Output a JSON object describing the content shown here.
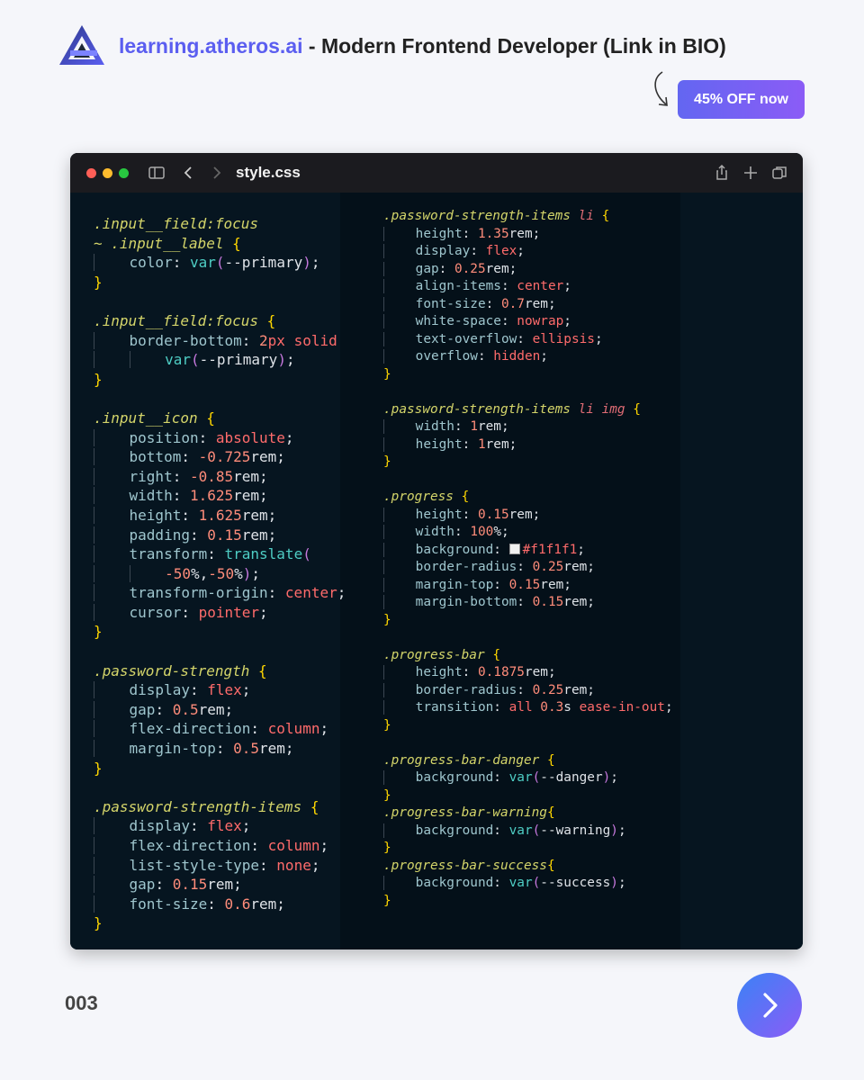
{
  "header": {
    "brand": "learning.atheros.ai",
    "separator": " - ",
    "tagline": "Modern Frontend Developer (Link in BIO)"
  },
  "promo": {
    "label": "45% OFF now"
  },
  "window": {
    "title": "style.css"
  },
  "code": {
    "left": {
      "l1": ".input__field:focus",
      "l2": "~ .input__label",
      "l5": ".input__field:focus",
      "l8": ".input__icon",
      "l19": ".password-strength",
      "l25": ".password-strength-items"
    },
    "right": {
      "r1": ".password-strength-items",
      "r1b": "li",
      "r10": ".password-strength-items",
      "r10b": "li img",
      "r14": ".progress",
      "r22": ".progress-bar",
      "r27": ".progress-bar-danger",
      "r30": ".progress-bar-warning",
      "r32": ".progress-bar-success"
    }
  },
  "footer": {
    "page_number": "003"
  },
  "icons": {
    "logo": "atheros-logo-icon",
    "hint_arrow": "curved-arrow-icon",
    "sidebar": "sidebar-icon",
    "back": "chevron-left-icon",
    "forward": "chevron-right-icon",
    "share": "share-icon",
    "new_tab": "plus-icon",
    "tabs": "tabs-icon",
    "next": "chevron-right-icon"
  },
  "colors": {
    "accent": "#5b5ef0",
    "editor_bg": "#061520",
    "titlebar": "#1b1b1f",
    "dot_close": "#ff5f57",
    "dot_min": "#febc2e",
    "dot_max": "#28c840"
  }
}
